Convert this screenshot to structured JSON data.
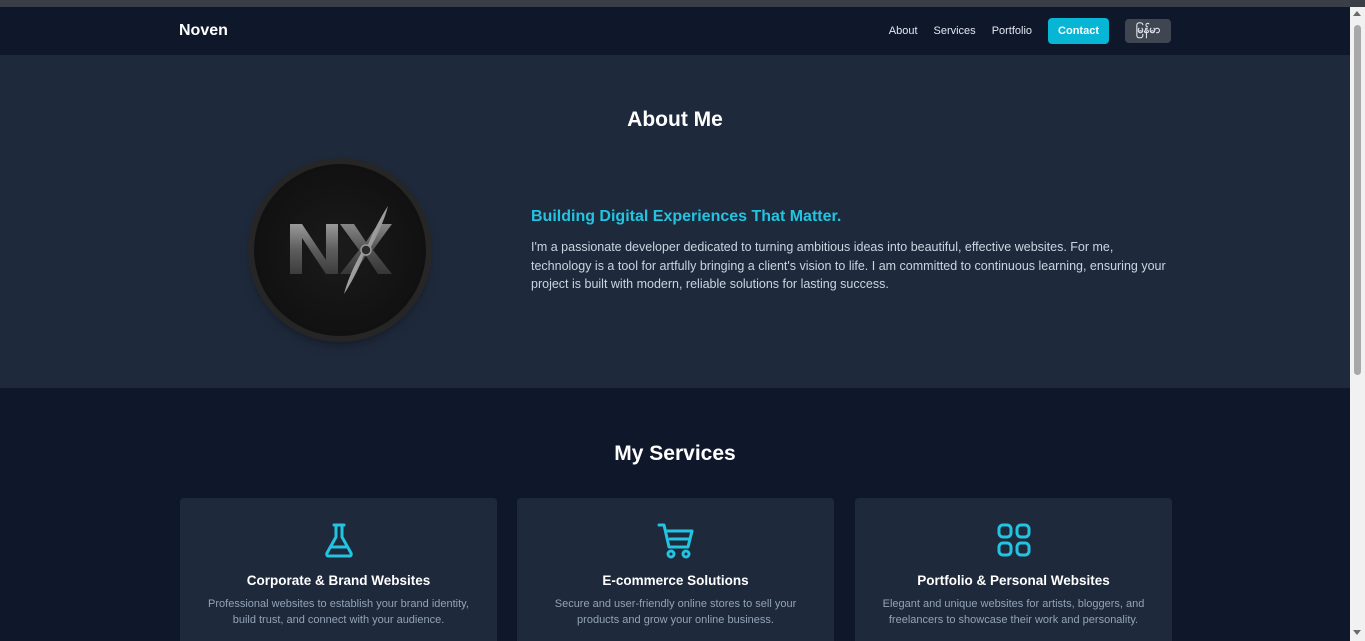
{
  "header": {
    "brand": "Noven",
    "nav": [
      {
        "label": "About"
      },
      {
        "label": "Services"
      },
      {
        "label": "Portfolio"
      }
    ],
    "contact_label": "Contact",
    "lang_label": "မြန်မာ"
  },
  "about": {
    "title": "About Me",
    "logo_text": "NX",
    "headline": "Building Digital Experiences That Matter.",
    "body": "I'm a passionate developer dedicated to turning ambitious ideas into beautiful, effective websites. For me, technology is a tool for artfully bringing a client's vision to life. I am committed to continuous learning, ensuring your project is built with modern, reliable solutions for lasting success."
  },
  "services": {
    "title": "My Services",
    "cards": [
      {
        "icon": "flask-icon",
        "title": "Corporate & Brand Websites",
        "desc": "Professional websites to establish your brand identity, build trust, and connect with your audience."
      },
      {
        "icon": "cart-icon",
        "title": "E-commerce Solutions",
        "desc": "Secure and user-friendly online stores to sell your products and grow your online business."
      },
      {
        "icon": "grid-icon",
        "title": "Portfolio & Personal Websites",
        "desc": "Elegant and unique websites for artists, bloggers, and freelancers to showcase their work and personality."
      }
    ]
  },
  "colors": {
    "accent": "#06b6d4",
    "headline": "#22c4e0",
    "bg_dark": "#0f172a",
    "bg_section": "#1e293b"
  }
}
